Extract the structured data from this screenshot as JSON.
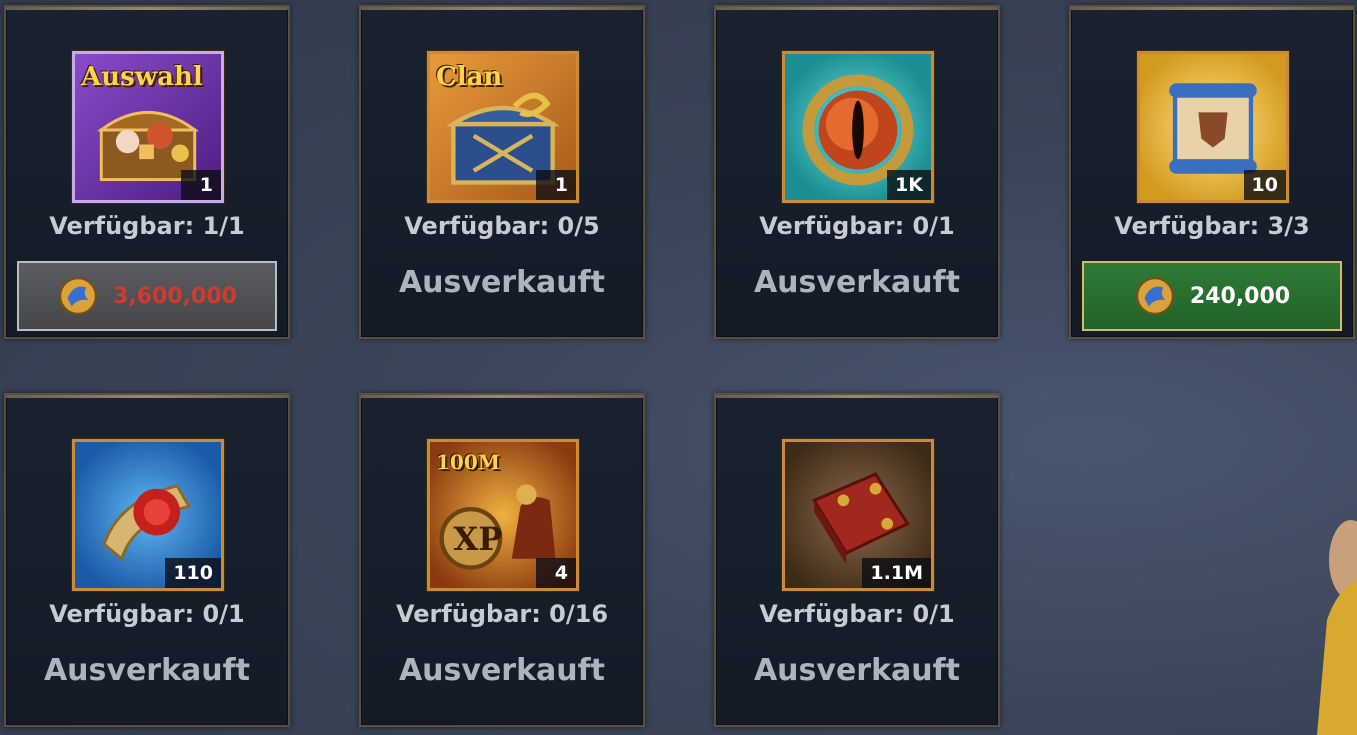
{
  "shop": {
    "items": [
      {
        "corner_label": "Auswahl",
        "quantity": "1",
        "available": "Verfügbar: 1/1",
        "status": "",
        "price": "3,600,000",
        "icon": "selection-chest-icon"
      },
      {
        "corner_label": "Clan",
        "quantity": "1",
        "available": "Verfügbar: 0/5",
        "status": "Ausverkauft",
        "price": "",
        "icon": "clan-chest-icon"
      },
      {
        "corner_label": "",
        "quantity": "1K",
        "available": "Verfügbar: 0/1",
        "status": "Ausverkauft",
        "price": "",
        "icon": "dragon-eye-orb-icon"
      },
      {
        "corner_label": "",
        "quantity": "10",
        "available": "Verfügbar: 3/3",
        "status": "",
        "price": "240,000",
        "icon": "scroll-icon"
      },
      {
        "corner_label": "",
        "quantity": "110",
        "available": "Verfügbar: 0/1",
        "status": "Ausverkauft",
        "price": "",
        "icon": "sealed-scroll-icon"
      },
      {
        "corner_label": "100M",
        "quantity": "4",
        "available": "Verfügbar: 0/16",
        "status": "Ausverkauft",
        "price": "",
        "icon": "xp-cavalry-icon"
      },
      {
        "corner_label": "",
        "quantity": "1.1M",
        "available": "Verfügbar: 0/1",
        "status": "Ausverkauft",
        "price": "",
        "icon": "red-book-icon"
      }
    ]
  },
  "colors": {
    "price_unaffordable": "#d33a2e",
    "buy_button": "#2f7a36",
    "card_border": "#5a5040",
    "icon_frame": "#c98a3a"
  }
}
